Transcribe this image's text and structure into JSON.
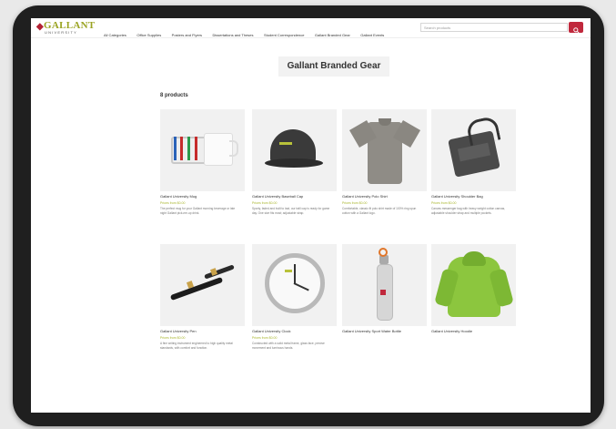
{
  "brand": {
    "name": "GALLANT",
    "sub": "UNIVERSITY"
  },
  "nav": [
    "All Categories",
    "Office Supplies",
    "Posters and Flyers",
    "Dissertations and Theses",
    "Student Correspondence",
    "Gallant Branded Gear",
    "Gallant Events"
  ],
  "search": {
    "placeholder": "Search products"
  },
  "page_title": "Gallant Branded Gear",
  "product_count": "8 products",
  "products": [
    {
      "name": "Gallant University Mug",
      "price": "Prices from $0.00",
      "desc": "The perfect mug for your Gallant morning beverage or late night Gallant pick-me-up drink."
    },
    {
      "name": "Gallant University Baseball Cap",
      "price": "Prices from $0.00",
      "desc": "Sporty, faded and built to last, our twill cap is ready for game day. One size fits most; adjustable strap."
    },
    {
      "name": "Gallant University Polo Shirt",
      "price": "Prices from $0.00",
      "desc": "Comfortable, classic fit polo shirt made of 100% ring spun cotton with a Gallant logo."
    },
    {
      "name": "Gallant University Shoulder Bag",
      "price": "Prices from $0.00",
      "desc": "Canvas messenger bag with heavy weight cotton canvas, adjustable shoulder strap and multiple pockets."
    },
    {
      "name": "Gallant University Pen",
      "price": "Prices from $0.00",
      "desc": "A fine writing instrument engineered to high quality metal standards, with comfort and function."
    },
    {
      "name": "Gallant University Clock",
      "price": "Prices from $0.00",
      "desc": "Constructed with a solid metal frame, glass face, precise movement and luminous hands."
    },
    {
      "name": "Gallant University Sport Water Bottle",
      "price": "",
      "desc": ""
    },
    {
      "name": "Gallant University Hoodie",
      "price": "",
      "desc": ""
    }
  ]
}
